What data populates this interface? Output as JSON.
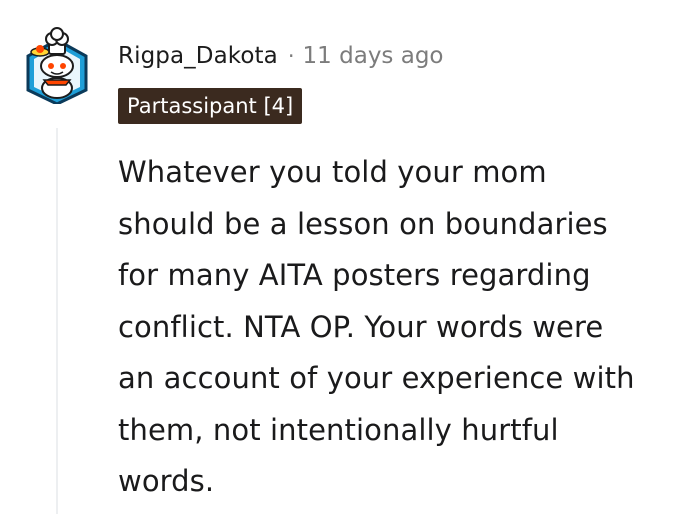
{
  "comment": {
    "username": "Rigpa_Dakota",
    "separator": "·",
    "timestamp": "11 days ago",
    "flair": "Partassipant [4]",
    "avatar_icon": "snoo-avatar-icon",
    "body_lines": [
      "Whatever you told your mom",
      "should be a lesson on boundaries",
      "for many AITA posters regarding",
      "conflict. NTA OP. Your words were",
      "an account of your experience with",
      "them, not intentionally hurtful",
      "words."
    ]
  },
  "colors": {
    "flair_background": "#3b2a1f",
    "flair_text": "#ffffff",
    "username": "#1c1c1c",
    "meta": "#7c7c7c",
    "body": "#1a1a1b",
    "thread_line": "#edeff1"
  }
}
